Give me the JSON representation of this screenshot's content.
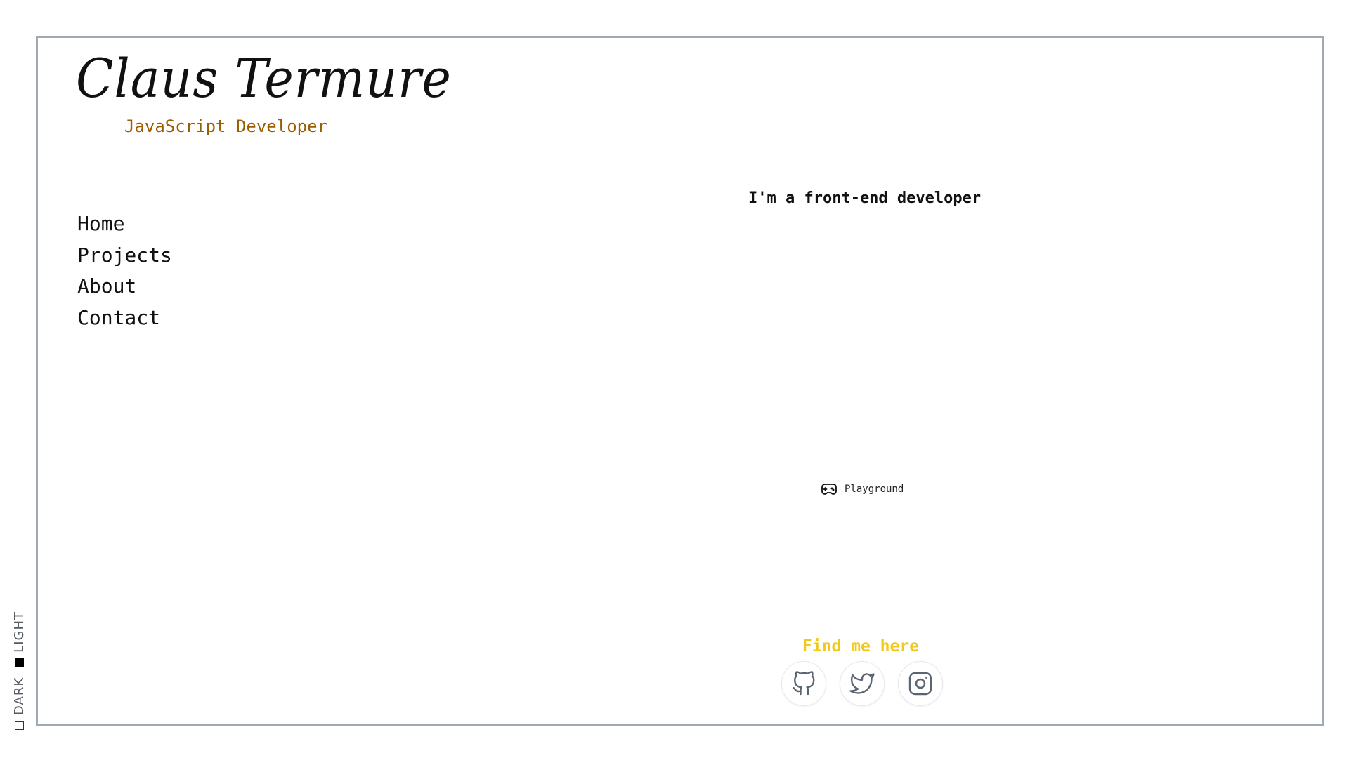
{
  "brand": {
    "name": "Claus Termure",
    "role": "JavaScript Developer"
  },
  "nav": {
    "items": [
      {
        "label": "Home"
      },
      {
        "label": "Projects"
      },
      {
        "label": "About"
      },
      {
        "label": "Contact"
      }
    ]
  },
  "main": {
    "intro": "I'm a front-end developer",
    "playground_label": "Playground",
    "playground_icon": "gamepad-icon"
  },
  "footer": {
    "find_title": "Find me here",
    "socials": [
      {
        "icon": "github-icon"
      },
      {
        "icon": "twitter-icon"
      },
      {
        "icon": "instagram-icon"
      }
    ]
  },
  "theme_toggle": {
    "dark_label": "DARK",
    "light_label": "LIGHT",
    "selected": "light"
  },
  "colors": {
    "accent_role": "#9c5c00",
    "accent_find": "#f1c91d",
    "frame_border": "#a0a9b4",
    "icon_stroke": "#5a6472"
  }
}
